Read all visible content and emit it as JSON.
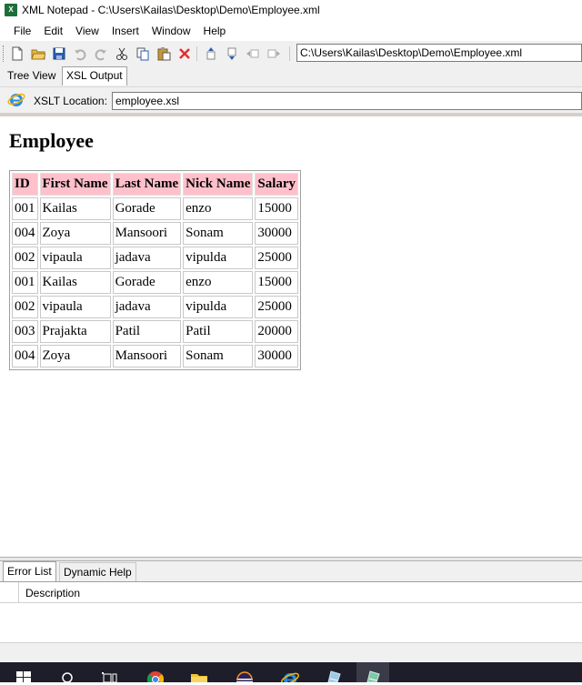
{
  "window": {
    "title": "XML Notepad - C:\\Users\\Kailas\\Desktop\\Demo\\Employee.xml"
  },
  "menu": [
    "File",
    "Edit",
    "View",
    "Insert",
    "Window",
    "Help"
  ],
  "toolbar": {
    "icons": [
      "new-file-icon",
      "open-folder-icon",
      "save-icon",
      "undo-icon",
      "redo-icon",
      "cut-icon",
      "copy-icon",
      "paste-icon",
      "delete-icon",
      "nudge-up-icon",
      "nudge-down-icon",
      "nudge-left-icon",
      "nudge-right-icon"
    ],
    "path": "C:\\Users\\Kailas\\Desktop\\Demo\\Employee.xml"
  },
  "tabs": [
    {
      "label": "Tree View",
      "active": false
    },
    {
      "label": "XSL Output",
      "active": true
    }
  ],
  "xslt": {
    "label": "XSLT Location:",
    "value": "employee.xsl"
  },
  "output": {
    "heading": "Employee",
    "columns": [
      "ID",
      "First Name",
      "Last Name",
      "Nick Name",
      "Salary"
    ],
    "rows": [
      [
        "001",
        "Kailas",
        "Gorade",
        "enzo",
        "15000"
      ],
      [
        "004",
        "Zoya",
        "Mansoori",
        "Sonam",
        "30000"
      ],
      [
        "002",
        "vipaula",
        "jadava",
        "vipulda",
        "25000"
      ],
      [
        "001",
        "Kailas",
        "Gorade",
        "enzo",
        "15000"
      ],
      [
        "002",
        "vipaula",
        "jadava",
        "vipulda",
        "25000"
      ],
      [
        "003",
        "Prajakta",
        "Patil",
        "Patil",
        "20000"
      ],
      [
        "004",
        "Zoya",
        "Mansoori",
        "Sonam",
        "30000"
      ]
    ],
    "header_bg": "#ffc0cb"
  },
  "bottom_tabs": [
    {
      "label": "Error List",
      "active": true
    },
    {
      "label": "Dynamic Help",
      "active": false
    }
  ],
  "error_list": {
    "column": "Description"
  },
  "taskbar": [
    "windows-start-icon",
    "search-icon",
    "task-view-icon",
    "chrome-icon",
    "file-explorer-icon",
    "eclipse-icon",
    "internet-explorer-icon",
    "notepad-app-icon",
    "xml-notepad-app-icon"
  ]
}
